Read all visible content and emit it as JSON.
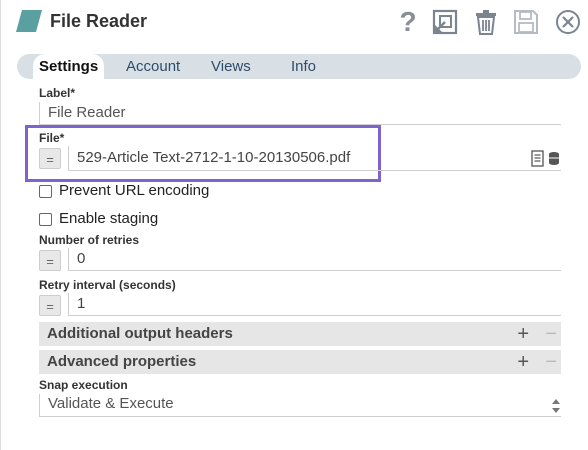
{
  "header": {
    "title": "File Reader",
    "brand_color": "#5aa0a0",
    "icons": [
      "help-icon",
      "export-icon",
      "delete-icon",
      "save-icon",
      "close-icon"
    ]
  },
  "tabs": [
    {
      "label": "Settings",
      "active": true
    },
    {
      "label": "Account",
      "active": false
    },
    {
      "label": "Views",
      "active": false
    },
    {
      "label": "Info",
      "active": false
    }
  ],
  "fields": {
    "label": {
      "name": "Label*",
      "value": "File Reader"
    },
    "file": {
      "name": "File*",
      "value": "529-Article Text-2712-1-10-20130506.pdf",
      "expr_button": "="
    },
    "prevent_url_encoding": {
      "label": "Prevent URL encoding",
      "checked": false
    },
    "enable_staging": {
      "label": "Enable staging",
      "checked": false
    },
    "retries": {
      "name": "Number of retries",
      "value": "0",
      "expr_button": "="
    },
    "retry_interval": {
      "name": "Retry interval (seconds)",
      "value": "1",
      "expr_button": "="
    },
    "snap_execution": {
      "name": "Snap execution",
      "value": "Validate & Execute"
    }
  },
  "sections": {
    "additional_headers": {
      "label": "Additional output headers",
      "plus": "+",
      "minus": "−"
    },
    "advanced": {
      "label": "Advanced properties",
      "plus": "+",
      "minus": "−"
    }
  },
  "highlight_color": "#7f63cc"
}
